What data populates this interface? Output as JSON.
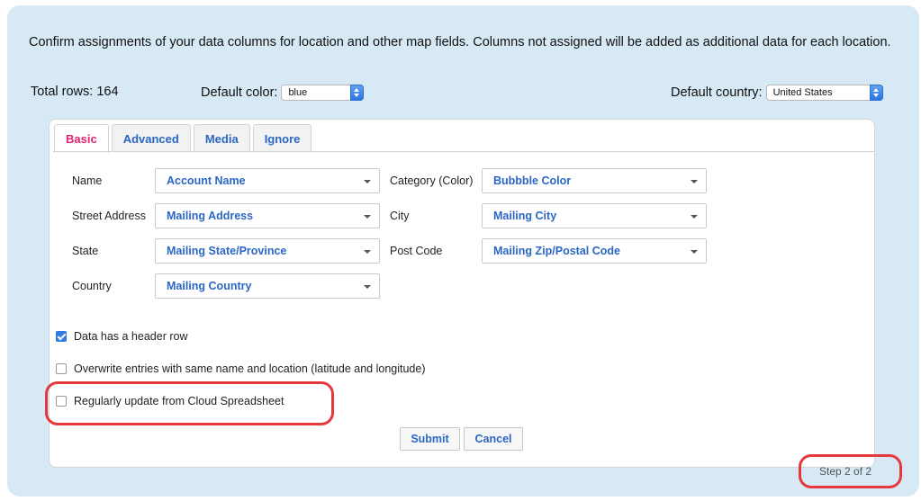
{
  "intro_text": "Confirm assignments of your data columns for location and other map fields. Columns not assigned will be added as additional data for each location.",
  "total_rows_label": "Total rows: 164",
  "default_color": {
    "label": "Default color:",
    "value": "blue"
  },
  "default_country": {
    "label": "Default country:",
    "value": "United States"
  },
  "tabs": [
    {
      "label": "Basic",
      "active": true
    },
    {
      "label": "Advanced",
      "active": false
    },
    {
      "label": "Media",
      "active": false
    },
    {
      "label": "Ignore",
      "active": false
    }
  ],
  "fields": {
    "name": {
      "label": "Name",
      "value": "Account Name"
    },
    "category": {
      "label": "Category (Color)",
      "value": "Bubbble Color"
    },
    "street": {
      "label": "Street Address",
      "value": "Mailing Address"
    },
    "city": {
      "label": "City",
      "value": "Mailing City"
    },
    "state": {
      "label": "State",
      "value": "Mailing State/Province"
    },
    "postcode": {
      "label": "Post Code",
      "value": "Mailing Zip/Postal Code"
    },
    "country": {
      "label": "Country",
      "value": "Mailing Country"
    }
  },
  "options": {
    "header_row": {
      "label": "Data has a header row",
      "checked": true
    },
    "overwrite": {
      "label": "Overwrite entries with same name and location (latitude and longitude)",
      "checked": false
    },
    "regular_update": {
      "label": "Regularly update from Cloud Spreadsheet",
      "checked": false
    }
  },
  "buttons": {
    "submit": "Submit",
    "cancel": "Cancel"
  },
  "step_text": "Step 2 of 2",
  "colors": {
    "accent_blue": "#2a66c4",
    "active_tab": "#e3236f",
    "panel_bg": "#d6e9f5",
    "highlight_red": "#e5393b"
  }
}
